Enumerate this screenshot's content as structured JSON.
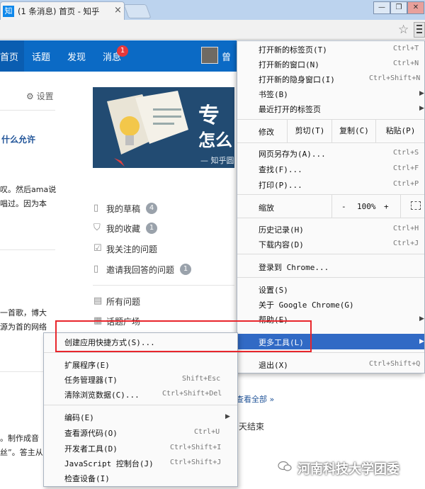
{
  "browser": {
    "tab_favicon": "知",
    "tab_title": "(1 条消息) 首页 - 知乎",
    "tab_close": "×",
    "window_minimize": "—",
    "window_restore": "❐",
    "window_close": "✕"
  },
  "site": {
    "nav": [
      "首页",
      "话题",
      "发现",
      "消息"
    ],
    "message_badge": "1",
    "username": "曾",
    "settings": "设置",
    "left_title": "什么允许",
    "left_lines": [
      "叹。然后ama说",
      "唱过。因为本",
      "一首歌，博大",
      "源为首的网络",
      "。制作成音",
      "丝”。答主从"
    ],
    "banner_line1": "专",
    "banner_line2": "怎么",
    "banner_line3": "— 知乎圆",
    "sidebar": [
      {
        "label": "我的草稿",
        "count": "4"
      },
      {
        "label": "我的收藏",
        "count": "1"
      },
      {
        "label": "我关注的问题",
        "count": ""
      },
      {
        "label": "邀请我回答的问题",
        "count": "1"
      },
      {
        "label": "所有问题",
        "count": ""
      },
      {
        "label": "话题广场",
        "count": ""
      }
    ],
    "see_all": "查看全部 »",
    "days_end": "天结束"
  },
  "menu": {
    "items": [
      {
        "label": "打开新的标签页(T)",
        "shortcut": "Ctrl+T"
      },
      {
        "label": "打开新的窗口(N)",
        "shortcut": "Ctrl+N"
      },
      {
        "label": "打开新的隐身窗口(I)",
        "shortcut": "Ctrl+Shift+N"
      },
      {
        "label": "书签(B)",
        "shortcut": ""
      },
      {
        "label": "最近打开的标签页",
        "shortcut": ""
      }
    ],
    "edit_label": "修改",
    "cut": "剪切(T)",
    "copy": "复制(C)",
    "paste": "粘贴(P)",
    "save_as": {
      "label": "网页另存为(A)...",
      "shortcut": "Ctrl+S"
    },
    "find": {
      "label": "查找(F)...",
      "shortcut": "Ctrl+F"
    },
    "print": {
      "label": "打印(P)...",
      "shortcut": "Ctrl+P"
    },
    "zoom_label": "缩放",
    "zoom_minus": "-",
    "zoom_value": "100%",
    "zoom_plus": "+",
    "history": {
      "label": "历史记录(H)",
      "shortcut": "Ctrl+H"
    },
    "downloads": {
      "label": "下载内容(D)",
      "shortcut": "Ctrl+J"
    },
    "signin": "登录到 Chrome...",
    "settings": "设置(S)",
    "about": "关于 Google Chrome(G)",
    "help": "帮助(E)",
    "more_tools": "更多工具(L)",
    "exit": {
      "label": "退出(X)",
      "shortcut": "Ctrl+Shift+Q"
    }
  },
  "submenu": {
    "create_shortcut": "创建应用快捷方式(S)...",
    "extensions": "扩展程序(E)",
    "task_manager": {
      "label": "任务管理器(T)",
      "shortcut": "Shift+Esc"
    },
    "clear_data": {
      "label": "清除浏览数据(C)...",
      "shortcut": "Ctrl+Shift+Del"
    },
    "encoding": "编码(E)",
    "view_source": {
      "label": "查看源代码(O)",
      "shortcut": "Ctrl+U"
    },
    "dev_tools": {
      "label": "开发者工具(D)",
      "shortcut": "Ctrl+Shift+I"
    },
    "js_console": {
      "label": "JavaScript 控制台(J)",
      "shortcut": "Ctrl+Shift+J"
    },
    "inspect": "检查设备(I)"
  },
  "watermark": "河南科技大学团委",
  "icons": {
    "star": "star-icon",
    "menu": "hamburger-menu-icon",
    "gear": "gear-icon",
    "wechat": "wechat-icon"
  }
}
